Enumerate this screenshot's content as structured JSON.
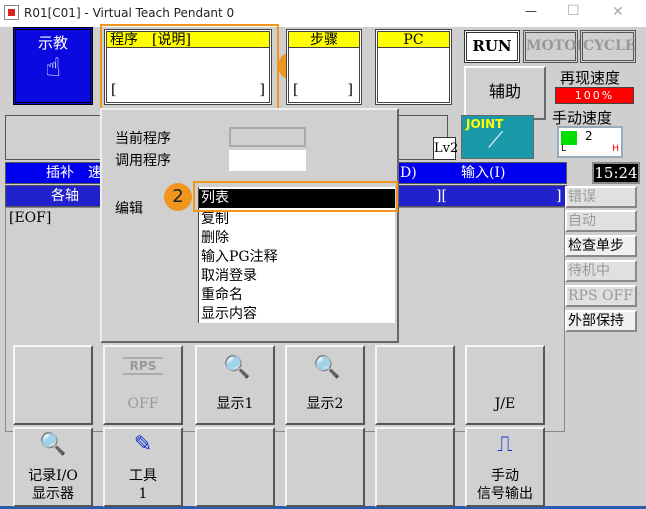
{
  "window": {
    "title": "R01[C01] - Virtual Teach Pendant 0",
    "minimize": "—",
    "maximize": "☐",
    "close": "✕"
  },
  "mode": {
    "label": "示教",
    "icon": "hand-pointer-icon"
  },
  "program_box": {
    "header": "程序　[说明]",
    "bracket_left": "[",
    "bracket_right": "]"
  },
  "step_box": {
    "header": "步骤",
    "bracket_left": "[",
    "bracket_right": "]"
  },
  "pc_box": {
    "header": "PC"
  },
  "status_buttons": {
    "run": "RUN",
    "motor": "MOTOR",
    "cycle": "CYCLE"
  },
  "aux_button": "辅助",
  "replay_speed": {
    "label": "再现速度",
    "value": "100%",
    "color": "#ff0000"
  },
  "manual_speed": {
    "label": "手动速度",
    "value": "2",
    "low": "L",
    "high": "H",
    "level_fraction": 0.25
  },
  "level": "Lv2",
  "coord_mode": "JOINT",
  "clock": "15:24",
  "bar1": {
    "left": "插补　速",
    "mid": "D)",
    "right": "输入(I)"
  },
  "bar2": {
    "left": "各轴",
    "mid": "][",
    "right": "]"
  },
  "content": {
    "eof": "[EOF]"
  },
  "panel": {
    "current_program": "当前程序",
    "called_program": "调用程序",
    "edit": "编辑",
    "edit_items": [
      "列表",
      "复制",
      "删除",
      "输入PG注释",
      "取消登录",
      "重命名",
      "显示内容"
    ],
    "selected": "列表"
  },
  "badges": [
    "1",
    "2"
  ],
  "side_status": [
    {
      "label": "错误",
      "active": false
    },
    {
      "label": "自动",
      "active": false
    },
    {
      "label": "检查单步",
      "active": true
    },
    {
      "label": "待机中",
      "active": false
    },
    {
      "label": "RPS OFF",
      "active": false
    },
    {
      "label": "外部保持",
      "active": true
    }
  ],
  "fkeys_row1": [
    {
      "label": ""
    },
    {
      "label": "OFF",
      "top": "RPS",
      "disabled": true
    },
    {
      "label": "显示1"
    },
    {
      "label": "显示2"
    },
    {
      "label": ""
    },
    {
      "label": "J/E"
    }
  ],
  "fkeys_row2": [
    {
      "label1": "记录I/O",
      "label2": "显示器"
    },
    {
      "label1": "工具",
      "label2": "1"
    },
    {
      "label1": "",
      "label2": ""
    },
    {
      "label1": "",
      "label2": ""
    },
    {
      "label1": "",
      "label2": ""
    },
    {
      "label1": "手动",
      "label2": "信号输出"
    }
  ],
  "accent": "#f0961e"
}
